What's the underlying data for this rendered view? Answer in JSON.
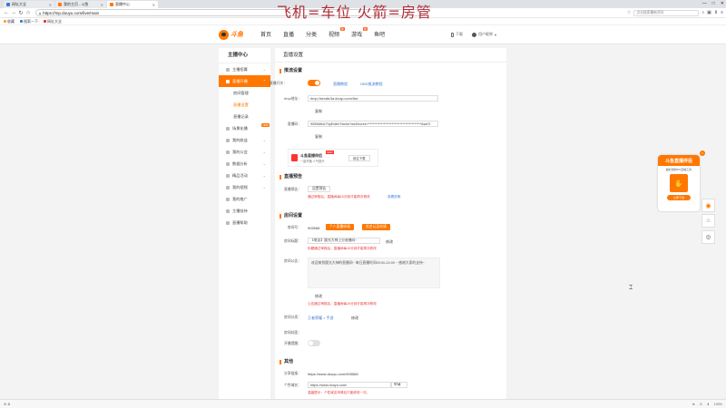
{
  "browser": {
    "tabs": [
      {
        "label": "网址大全",
        "color": "#3b7ad1",
        "active": false
      },
      {
        "label": "我的主页 - 斗鱼",
        "color": "#ff7700",
        "active": false
      },
      {
        "label": "直播中心",
        "color": "#ff7700",
        "active": true
      }
    ],
    "url": "https://mp.douyu.com/live/main",
    "side_search": "点击搜索最新资讯",
    "bookmarks": [
      "收藏",
      "搜索一下",
      "网址大全"
    ],
    "window_controls": [
      "—",
      "□",
      "✕"
    ]
  },
  "overlay_title": "飞机=车位 火箭=房管",
  "site": {
    "logo": "斗鱼",
    "nav": [
      {
        "label": "首页",
        "badge": ""
      },
      {
        "label": "直播",
        "badge": ""
      },
      {
        "label": "分类",
        "badge": ""
      },
      {
        "label": "视频",
        "badge": "新"
      },
      {
        "label": "游戏",
        "badge": "热"
      },
      {
        "label": "鱼吧",
        "badge": ""
      }
    ],
    "download_label": "下载",
    "user_label": "用户昵称"
  },
  "sidebar": {
    "title": "主播中心",
    "items": [
      {
        "label": "主播招募",
        "active": false
      },
      {
        "label": "直播开播",
        "active": true
      },
      {
        "label": "房间管理",
        "sub": true,
        "active": false
      },
      {
        "label": "直播设置",
        "sub": true,
        "active": true
      },
      {
        "label": "直播记录",
        "sub": true,
        "active": false
      },
      {
        "label": "场景化播",
        "active": false,
        "tag": "NEW"
      },
      {
        "label": "我的收益",
        "active": false
      },
      {
        "label": "我的公会",
        "active": false
      },
      {
        "label": "数据分析",
        "active": false
      },
      {
        "label": "精品活动",
        "active": false
      },
      {
        "label": "我的视频",
        "active": false
      },
      {
        "label": "我的推广",
        "active": false
      },
      {
        "label": "主播扶持",
        "active": false
      },
      {
        "label": "直播帮助",
        "active": false
      }
    ]
  },
  "main": {
    "title": "直播设置",
    "stream": {
      "section": "推流设置",
      "live_switch_label": "直播开关：",
      "tutorial_link": "直播教程",
      "obs_link": "OBS推流教程",
      "rtmp_label": "rtmp地址：",
      "rtmp_value": "rtmp://sendtc3a.douyu.com/live",
      "copy1": "复制",
      "code_label": "直播码：",
      "code_value": "905568rA7hyEx8mTwcke?wsSecret=****************************************&wsTi",
      "copy2": "复制",
      "promo_title": "斗鱼直播伴侣",
      "promo_sub": "一键开播 人气提升",
      "promo_tag": "NEW",
      "promo_button": "前往下载"
    },
    "preview": {
      "section": "直播预告",
      "label": "直播预告：",
      "button": "设置预告",
      "hint": "通过审核后，直播间每10分钟才能再次修改",
      "link": "查看说明"
    },
    "room": {
      "section": "房间设置",
      "id_label": "房间号：",
      "id_value": "905568",
      "btn_apply": "个人直播申请",
      "btn_verify": "实名认证申请",
      "name_label": "房间标题：",
      "name_value": "【电竞】晨光大神上分直播间~",
      "name_edit": "修改",
      "name_hint": "标题通过审核后，直播间每10分钟才能再次修改",
      "notice_label": "房间公告：",
      "notice_value": "欢迎来到晨光大神的直播间~ 每日直播时间09:00-24:00 ~ 感谢大家的支持~",
      "notice_edit": "修改",
      "notice_hint": "公告通过审核后，直播间每10分钟才能再次修改",
      "cat_label": "房间分类：",
      "cat_value": "王者荣耀 > 手游",
      "cat_edit": "修改",
      "cover_label": "房间封面：",
      "remind_label": "开播提醒："
    },
    "other": {
      "section": "其他",
      "share_label": "分享链接：",
      "share_value": "https://www.douyu.com/905568",
      "custom_label": "个性域名：",
      "custom_value": "https://www.douyu.com/",
      "custom_btn": "申请",
      "custom_hint": "温馨提示：个性域名申请后只能修改一次。"
    }
  },
  "float_ad": {
    "title": "斗鱼直播伴侣",
    "subtitle": "超好用的PC直播工具",
    "button": "立即下载"
  },
  "statusbar": {
    "left": "⚙ ⚙",
    "right": [
      "⊕",
      "⊡",
      "⬇",
      "100%"
    ]
  }
}
